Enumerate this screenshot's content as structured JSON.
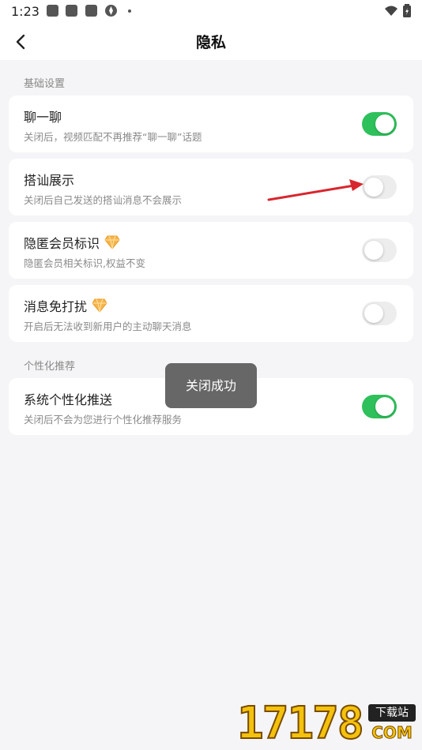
{
  "status_bar": {
    "time": "1:23",
    "icons": [
      "notification-icon",
      "notification-icon",
      "notification-icon",
      "shutter-icon",
      "dot-icon"
    ],
    "right_icons": [
      "wifi-icon",
      "battery-icon"
    ]
  },
  "nav": {
    "back_icon": "chevron-left-icon",
    "title": "隐私"
  },
  "sections": {
    "basic": "基础设置",
    "personalization": "个性化推荐"
  },
  "settings": [
    {
      "title": "聊一聊",
      "desc": "关闭后，视频匹配不再推荐“聊一聊”话题",
      "enabled": true,
      "vip": false
    },
    {
      "title": "搭讪展示",
      "desc": "关闭后自己发送的搭讪消息不会展示",
      "enabled": false,
      "vip": false
    },
    {
      "title": "隐匿会员标识",
      "desc": "隐匿会员相关标识,权益不变",
      "enabled": false,
      "vip": true
    },
    {
      "title": "消息免打扰",
      "desc": "开启后无法收到新用户的主动聊天消息",
      "enabled": false,
      "vip": true
    },
    {
      "title": "系统个性化推送",
      "desc": "关闭后不会为您进行个性化推荐服务",
      "enabled": true,
      "vip": false
    }
  ],
  "toast": "关闭成功",
  "watermark": {
    "digits": "17178",
    "badge": "下载站",
    "suffix": "COM"
  },
  "colors": {
    "toggle_on": "#2ec15b",
    "toggle_off": "#ededed",
    "background": "#f5f5f7",
    "annotation_arrow": "#d8262e"
  }
}
